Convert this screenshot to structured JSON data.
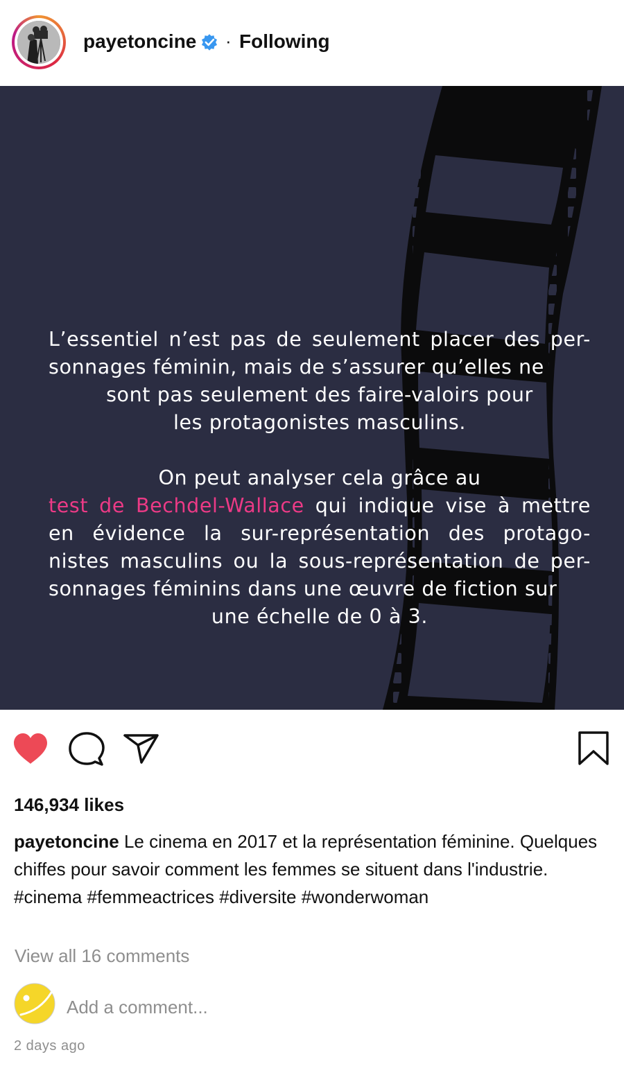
{
  "header": {
    "username": "payetoncine",
    "separator": "·",
    "follow_status": "Following"
  },
  "post": {
    "paragraph1": "L’essentiel n’est pas de seulement placer des per-sonnages féminin, mais de s’assurer qu’elles ne",
    "paragraph1_center": "sont pas seulement des faire-valoirs pour",
    "paragraph1_center2": "les protagonistes masculins.",
    "paragraph2_line1": "On peut analyser cela grâce au",
    "paragraph2_highlight": "test de Bechdel-Wallace",
    "paragraph2_rest": " qui indique vise à mettre en évidence la sur-représentation des protago-nistes masculins ou la sous-représentation de per-sonnages féminins dans une œuvre de fiction sur",
    "paragraph2_last": "une échelle de 0 à 3.",
    "highlight_color": "#ec3a86",
    "background_color": "#2b2d42"
  },
  "actions": {
    "like_icon": "heart-icon",
    "comment_icon": "comment-icon",
    "share_icon": "paper-plane-icon",
    "save_icon": "bookmark-icon",
    "like_color": "#ed4956"
  },
  "likes": "146,934 likes",
  "caption": {
    "username": "payetoncine",
    "text": " Le cinema en 2017 et la représentation féminine. Quelques chiffes pour savoir comment les femmes se situent dans l'industrie.",
    "hashtags": "#cinema #femmeactrices #diversite #wonderwoman"
  },
  "comments_link": "View all 16 comments",
  "add_comment_placeholder": "Add a comment...",
  "timestamp": "2 days ago"
}
